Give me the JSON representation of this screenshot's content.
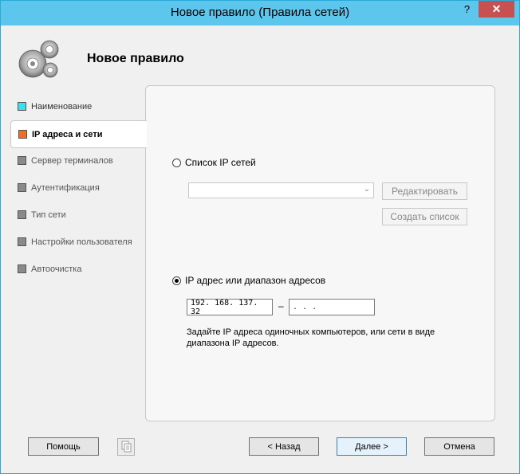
{
  "window": {
    "title": "Новое правило (Правила сетей)",
    "help_label": "?",
    "close_label": "✕"
  },
  "header": {
    "title": "Новое правило",
    "logo_icon": "gears-icon"
  },
  "nav": {
    "items": [
      {
        "label": "Наименование",
        "color": "#3de0e8",
        "state": "done"
      },
      {
        "label": "IP адреса и сети",
        "color": "#f07020",
        "state": "active"
      },
      {
        "label": "Сервер терминалов",
        "color": "#8a8a8a",
        "state": "disabled"
      },
      {
        "label": "Аутентификация",
        "color": "#8a8a8a",
        "state": "disabled"
      },
      {
        "label": "Тип сети",
        "color": "#8a8a8a",
        "state": "disabled"
      },
      {
        "label": "Настройки пользователя",
        "color": "#8a8a8a",
        "state": "disabled"
      },
      {
        "label": "Автоочистка",
        "color": "#8a8a8a",
        "state": "disabled"
      }
    ]
  },
  "content": {
    "option_list": {
      "label": "Список IP сетей",
      "selected": false
    },
    "combo_value": "",
    "edit_button": "Редактировать",
    "create_button": "Создать список",
    "option_range": {
      "label": "IP адрес или диапазон адресов",
      "selected": true
    },
    "ip_start": "192. 168. 137.  32",
    "ip_separator": "–",
    "ip_end": "   .     .     .",
    "hint": "Задайте IP адреса одиночных компьютеров, или сети в виде диапазона IP адресов."
  },
  "footer": {
    "help": "Помощь",
    "copy_icon": "copy-icon",
    "back": "< Назад",
    "next": "Далее >",
    "cancel": "Отмена"
  }
}
